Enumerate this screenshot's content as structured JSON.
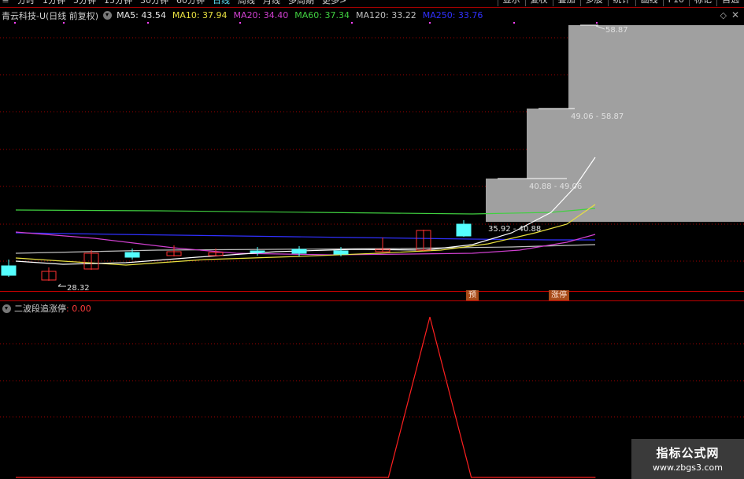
{
  "toolbar": {
    "menu_icon": "menu-icon",
    "periods": [
      "分时",
      "1分钟",
      "5分钟",
      "15分钟",
      "30分钟",
      "60分钟",
      "日线",
      "周线",
      "月线",
      "多周期",
      "更多>"
    ],
    "active_period": "日线",
    "buttons": [
      "显示",
      "复权",
      "叠加",
      "多股",
      "统计",
      "画线",
      "F10",
      "标记",
      "自选"
    ]
  },
  "info": {
    "title": "青云科技-U(日线 前复权)",
    "ma": [
      {
        "label": "MA5: 43.54",
        "color": "#e8e8e8"
      },
      {
        "label": "MA10: 37.94",
        "color": "#e8e040"
      },
      {
        "label": "MA20: 34.40",
        "color": "#d040d0"
      },
      {
        "label": "MA60: 37.34",
        "color": "#40d040"
      },
      {
        "label": "MA120: 33.22",
        "color": "#c0c0c0"
      },
      {
        "label": "MA250: 33.76",
        "color": "#3030ff"
      }
    ]
  },
  "price_labels": {
    "low_marker": "28.32",
    "box1": "35.92 - 40.88",
    "box2": "40.88 - 49.06",
    "box3": "49.06 - 58.87",
    "high_marker": "58.87"
  },
  "tags": {
    "tag1": "预",
    "tag2": "涨停"
  },
  "indicator": {
    "name": "二波段追涨停",
    "value": ": 0.00",
    "series": [
      0,
      0,
      0,
      0,
      0,
      0,
      0,
      0,
      0,
      0,
      1,
      0,
      0,
      0,
      0
    ]
  },
  "watermark": {
    "title": "指标公式网",
    "url": "www.zbgs3.com"
  },
  "colors": {
    "up": "#ff3030",
    "down": "#54ffff",
    "grid": "#a00000",
    "indicator_line": "#ff2020",
    "box": "#a0a0a0"
  }
}
